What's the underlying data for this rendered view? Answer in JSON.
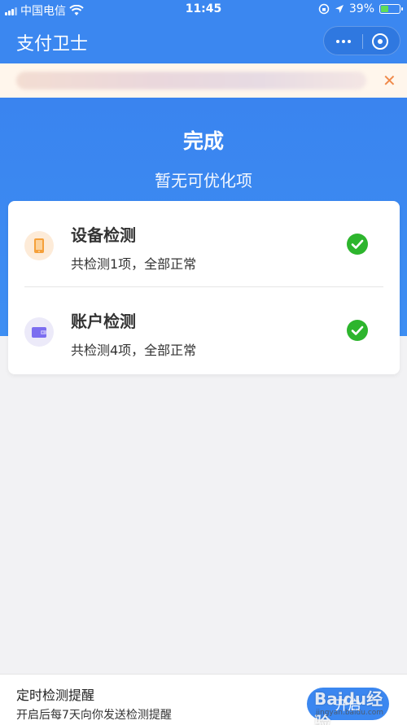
{
  "status_bar": {
    "carrier": "中国电信",
    "time": "11:45",
    "battery_percent": "39%",
    "battery_level": 0.39
  },
  "nav": {
    "title": "支付卫士",
    "more_icon": "more-dots-icon",
    "close_icon": "close-miniprogram-icon"
  },
  "notice": {
    "close_label": "✕"
  },
  "hero": {
    "title": "完成",
    "subtitle": "暂无可优化项"
  },
  "checks": [
    {
      "title": "设备检测",
      "desc": "共检测1项，全部正常",
      "icon": "phone-icon"
    },
    {
      "title": "账户检测",
      "desc": "共检测4项，全部正常",
      "icon": "wallet-icon"
    }
  ],
  "reminder": {
    "title": "定时检测提醒",
    "desc": "开启后每7天向你发送检测提醒",
    "button_label": "开启"
  },
  "watermark": {
    "logo": "Baidu经验",
    "url": "jingyan.baidu.com"
  },
  "colors": {
    "primary": "#3b87f0",
    "success": "#2db52d",
    "orange_icon": "#f5a03a",
    "purple_icon": "#7c6ef0"
  }
}
